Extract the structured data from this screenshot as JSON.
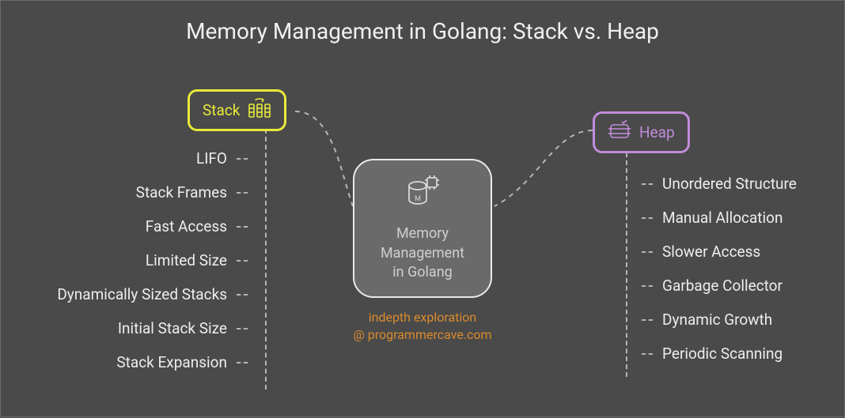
{
  "title": "Memory Management in Golang: Stack vs. Heap",
  "center": {
    "line1": "Memory",
    "line2": "Management",
    "line3": "in Golang"
  },
  "stack": {
    "label": "Stack",
    "items": [
      "LIFO",
      "Stack Frames",
      "Fast Access",
      "Limited Size",
      "Dynamically Sized Stacks",
      "Initial Stack Size",
      "Stack Expansion"
    ]
  },
  "heap": {
    "label": "Heap",
    "items": [
      "Unordered Structure",
      "Manual Allocation",
      "Slower Access",
      "Garbage Collector",
      "Dynamic Growth",
      "Periodic Scanning"
    ]
  },
  "footer": {
    "line1": "indepth exploration",
    "line2": "@ programmercave.com"
  },
  "colors": {
    "bg": "#4a4a4a",
    "stack_accent": "#e9e93a",
    "heap_accent": "#c18cd9",
    "footer": "#d98b2e"
  }
}
